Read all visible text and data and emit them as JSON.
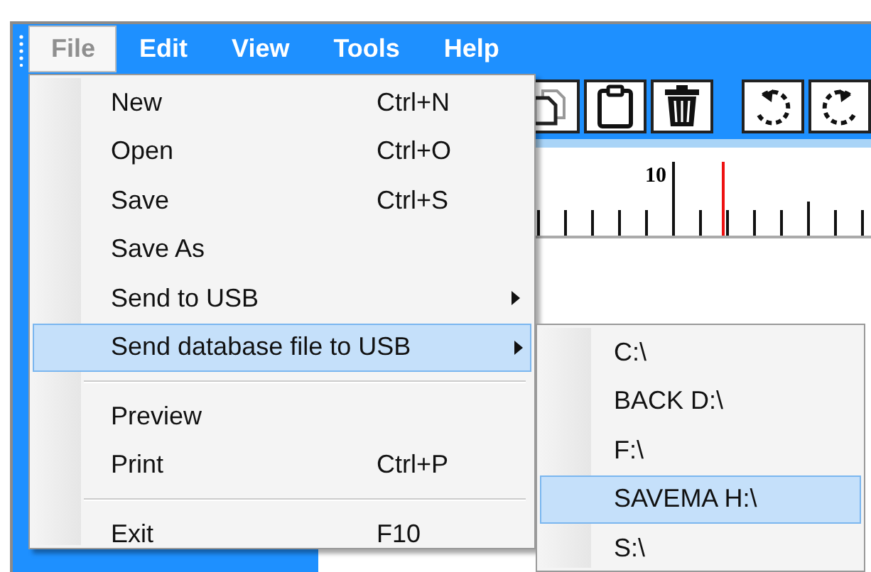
{
  "menubar": [
    {
      "label": "File",
      "selected": true
    },
    {
      "label": "Edit",
      "selected": false
    },
    {
      "label": "View",
      "selected": false
    },
    {
      "label": "Tools",
      "selected": false
    },
    {
      "label": "Help",
      "selected": false
    }
  ],
  "file_menu": {
    "items": [
      {
        "kind": "item",
        "label": "New",
        "shortcut": "Ctrl+N",
        "selected": false,
        "has_submenu": false
      },
      {
        "kind": "item",
        "label": "Open",
        "shortcut": "Ctrl+O",
        "selected": false,
        "has_submenu": false
      },
      {
        "kind": "item",
        "label": "Save",
        "shortcut": "Ctrl+S",
        "selected": false,
        "has_submenu": false
      },
      {
        "kind": "item",
        "label": "Save As",
        "selected": false,
        "has_submenu": false
      },
      {
        "kind": "item",
        "label": "Send to USB",
        "selected": false,
        "has_submenu": true
      },
      {
        "kind": "item",
        "label": "Send database file to USB",
        "selected": true,
        "has_submenu": true
      },
      {
        "kind": "separator"
      },
      {
        "kind": "item",
        "label": "Preview",
        "selected": false,
        "has_submenu": false
      },
      {
        "kind": "item",
        "label": "Print",
        "shortcut": "Ctrl+P",
        "selected": false,
        "has_submenu": false
      },
      {
        "kind": "separator"
      },
      {
        "kind": "item",
        "label": "Exit",
        "shortcut": "F10",
        "selected": false,
        "has_submenu": false
      }
    ]
  },
  "submenu": {
    "items": [
      {
        "label": "C:\\",
        "selected": false
      },
      {
        "label": "BACK D:\\",
        "selected": false
      },
      {
        "label": "F:\\",
        "selected": false
      },
      {
        "label": "SAVEMA H:\\",
        "selected": true
      },
      {
        "label": "S:\\",
        "selected": false
      }
    ]
  },
  "ruler": {
    "label": "10"
  }
}
